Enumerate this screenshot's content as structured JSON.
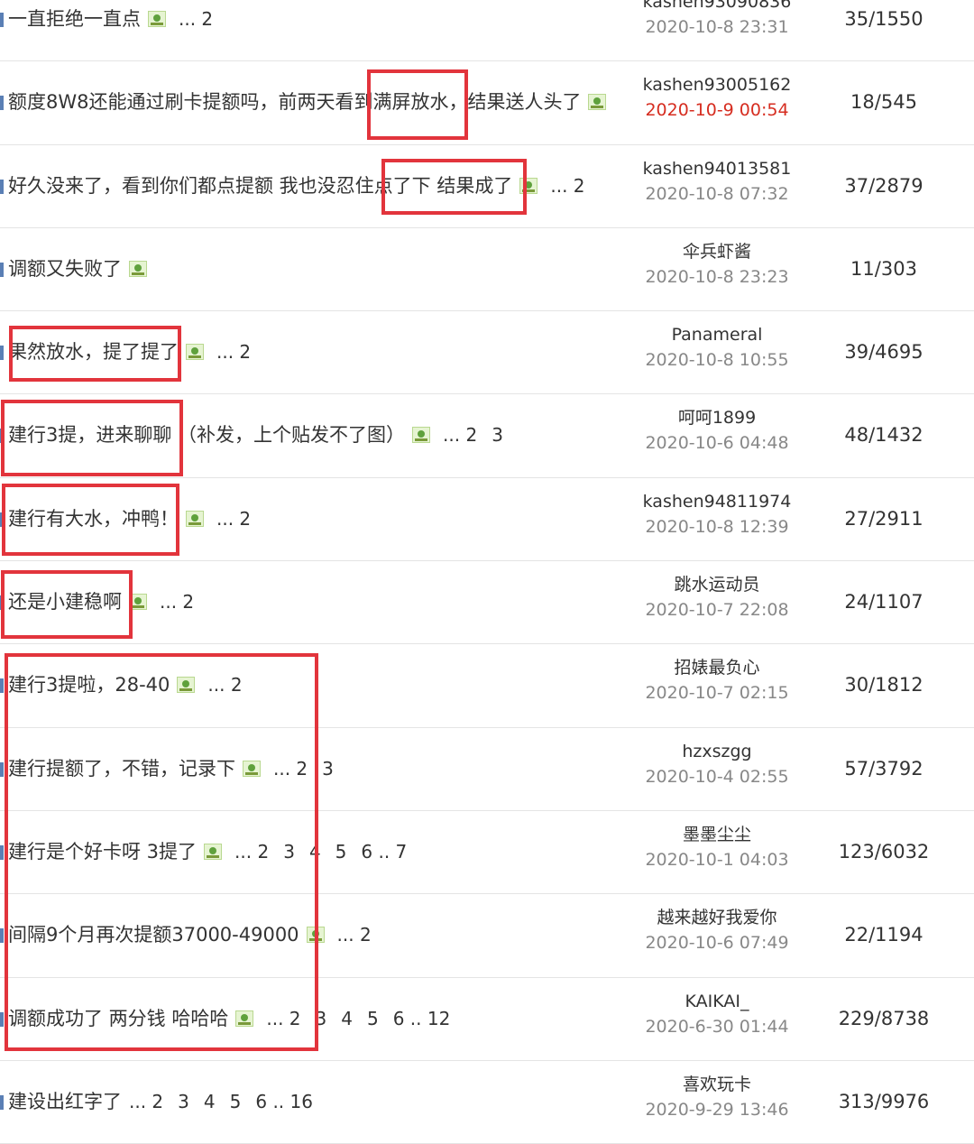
{
  "threads": [
    {
      "title": "一直拒绝一直点",
      "img": true,
      "pages": [
        "... 2"
      ],
      "author": "kashen93090836",
      "date": "2020-10-8 23:31",
      "date_new": false,
      "count": "35/1550"
    },
    {
      "title": "额度8W8还能通过刷卡提额吗，前两天看到满屏放水，结果送人头了",
      "img": true,
      "pages": [],
      "author": "kashen93005162",
      "date": "2020-10-9 00:54",
      "date_new": true,
      "count": "18/545"
    },
    {
      "title": "好久没来了，看到你们都点提额 我也没忍住点了下 结果成了",
      "img": true,
      "pages": [
        "... 2"
      ],
      "author": "kashen94013581",
      "date": "2020-10-8 07:32",
      "date_new": false,
      "count": "37/2879"
    },
    {
      "title": "调额又失败了",
      "img": true,
      "pages": [],
      "author": "伞兵虾酱",
      "date": "2020-10-8 23:23",
      "date_new": false,
      "count": "11/303"
    },
    {
      "title": "果然放水，提了提了",
      "img": true,
      "pages": [
        "... 2"
      ],
      "author": "Panameral",
      "date": "2020-10-8 10:55",
      "date_new": false,
      "count": "39/4695"
    },
    {
      "title": "建行3提，进来聊聊  （补发，上个贴发不了图）",
      "img": true,
      "pages": [
        "... 2",
        "3"
      ],
      "author": "呵呵1899",
      "date": "2020-10-6 04:48",
      "date_new": false,
      "count": "48/1432"
    },
    {
      "title": "建行有大水，冲鸭！",
      "img": true,
      "pages": [
        "... 2"
      ],
      "author": "kashen94811974",
      "date": "2020-10-8 12:39",
      "date_new": false,
      "count": "27/2911"
    },
    {
      "title": "还是小建稳啊",
      "img": true,
      "pages": [
        "... 2"
      ],
      "author": "跳水运动员",
      "date": "2020-10-7 22:08",
      "date_new": false,
      "count": "24/1107"
    },
    {
      "title": "建行3提啦，28-40",
      "img": true,
      "pages": [
        "... 2"
      ],
      "author": "招婊最负心",
      "date": "2020-10-7 02:15",
      "date_new": false,
      "count": "30/1812"
    },
    {
      "title": "建行提额了，不错，记录下",
      "img": true,
      "pages": [
        "... 2",
        "3"
      ],
      "author": "hzxszgg",
      "date": "2020-10-4 02:55",
      "date_new": false,
      "count": "57/3792"
    },
    {
      "title": "建行是个好卡呀 3提了",
      "img": true,
      "pages": [
        "... 2",
        "3",
        "4",
        "5",
        "6 .. 7"
      ],
      "author": "墨墨尘尘",
      "date": "2020-10-1 04:03",
      "date_new": false,
      "count": "123/6032"
    },
    {
      "title": "间隔9个月再次提额37000-49000",
      "img": true,
      "pages": [
        "... 2"
      ],
      "author": "越来越好我爱你",
      "date": "2020-10-6 07:49",
      "date_new": false,
      "count": "22/1194"
    },
    {
      "title": "调额成功了 两分钱 哈哈哈",
      "img": true,
      "pages": [
        "... 2",
        "3",
        "4",
        "5",
        "6 .. 12"
      ],
      "author": "KAIKAI_",
      "date": "2020-6-30 01:44",
      "date_new": false,
      "count": "229/8738"
    },
    {
      "title": "建设出红字了",
      "img": false,
      "pages": [
        "... 2",
        "3",
        "4",
        "5",
        "6 .. 16"
      ],
      "author": "喜欢玩卡",
      "date": "2020-9-29 13:46",
      "date_new": false,
      "count": "313/9976"
    }
  ],
  "colors": {
    "highlight_box": "#e2343c",
    "new_date": "#d62d20",
    "row_marker": "#5a7fb5"
  }
}
